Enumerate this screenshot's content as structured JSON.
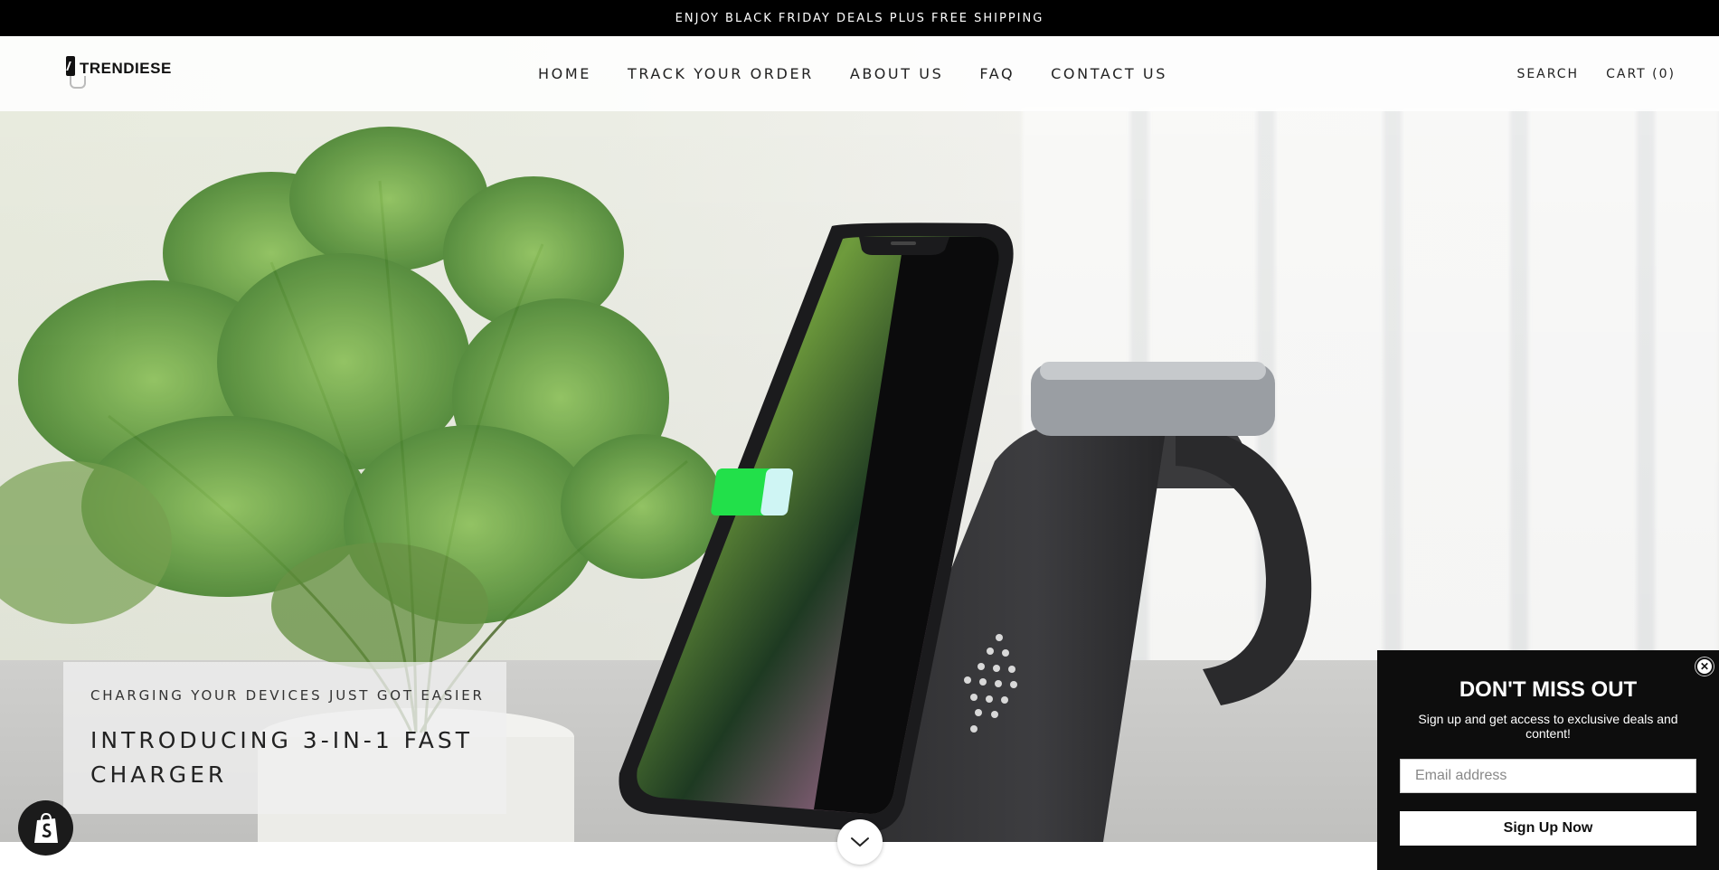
{
  "announcement": {
    "text": "ENJOY BLACK FRIDAY DEALS PLUS FREE SHIPPING"
  },
  "header": {
    "logo_text": "TRENDIESE",
    "nav": [
      {
        "label": "HOME"
      },
      {
        "label": "TRACK YOUR ORDER"
      },
      {
        "label": "ABOUT US"
      },
      {
        "label": "FAQ"
      },
      {
        "label": "CONTACT US"
      }
    ],
    "search_label": "SEARCH",
    "cart_label": "CART (0)"
  },
  "hero": {
    "subheading": "CHARGING YOUR DEVICES JUST GOT EASIER",
    "heading": "INTRODUCING 3-IN-1 FAST CHARGER",
    "scroll_icon": "chevron-down-icon"
  },
  "popup": {
    "title": "DON'T MISS OUT",
    "text": "Sign up and get access to exclusive deals and content!",
    "email_placeholder": "Email address",
    "button_label": "Sign Up Now",
    "close_icon": "close-icon"
  },
  "shopify_badge": {
    "icon": "shopify-bag-icon"
  },
  "colors": {
    "announcement_bg": "#000000",
    "popup_bg": "#0d0d0d",
    "battery_green": "#22e04a"
  }
}
